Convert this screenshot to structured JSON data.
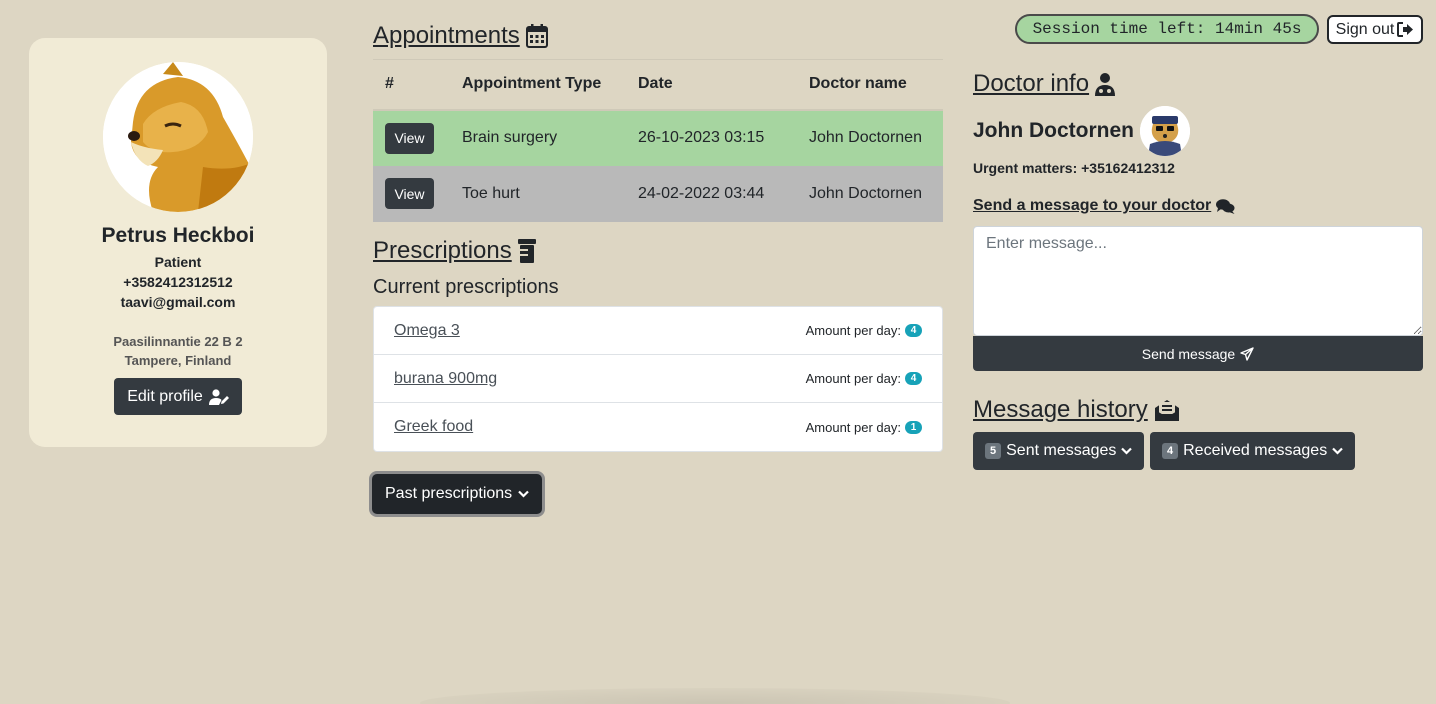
{
  "profile": {
    "name": "Petrus Heckboi",
    "role": "Patient",
    "phone": "+3582412312512",
    "email": "taavi@gmail.com",
    "address_line1": "Paasilinnantie 22 B 2",
    "address_line2": "Tampere, Finland",
    "edit_label": "Edit profile"
  },
  "appointments": {
    "title": "Appointments",
    "headers": [
      "#",
      "Appointment Type",
      "Date",
      "Doctor name"
    ],
    "rows": [
      {
        "action": "View",
        "type": "Brain surgery",
        "date": "26-10-2023 03:15",
        "doctor": "John Doctornen"
      },
      {
        "action": "View",
        "type": "Toe hurt",
        "date": "24-02-2022 03:44",
        "doctor": "John Doctornen"
      }
    ]
  },
  "prescriptions": {
    "title": "Prescriptions",
    "subtitle": "Current prescriptions",
    "amount_label": "Amount per day:",
    "items": [
      {
        "name": "Omega 3",
        "amount": "4"
      },
      {
        "name": "burana 900mg",
        "amount": "4"
      },
      {
        "name": "Greek food",
        "amount": "1"
      }
    ],
    "past_label": "Past prescriptions"
  },
  "session": {
    "text": "Session time left: 14min 45s",
    "signout_label": "Sign out"
  },
  "doctor": {
    "title": "Doctor info",
    "name": "John Doctornen",
    "urgent": "Urgent matters: +35162412312",
    "send_title": "Send a message to your doctor",
    "message_placeholder": "Enter message...",
    "send_label": "Send message"
  },
  "history": {
    "title": "Message history",
    "sent_count": "5",
    "sent_label": "Sent messages",
    "received_count": "4",
    "received_label": "Received messages"
  },
  "colors": {
    "background": "#ddd6c3",
    "card": "#f1ebd6",
    "row_highlight": "#a6d5a0",
    "row_past": "#b9b9b9",
    "button_dark": "#343a40",
    "badge": "#17a2b8"
  }
}
